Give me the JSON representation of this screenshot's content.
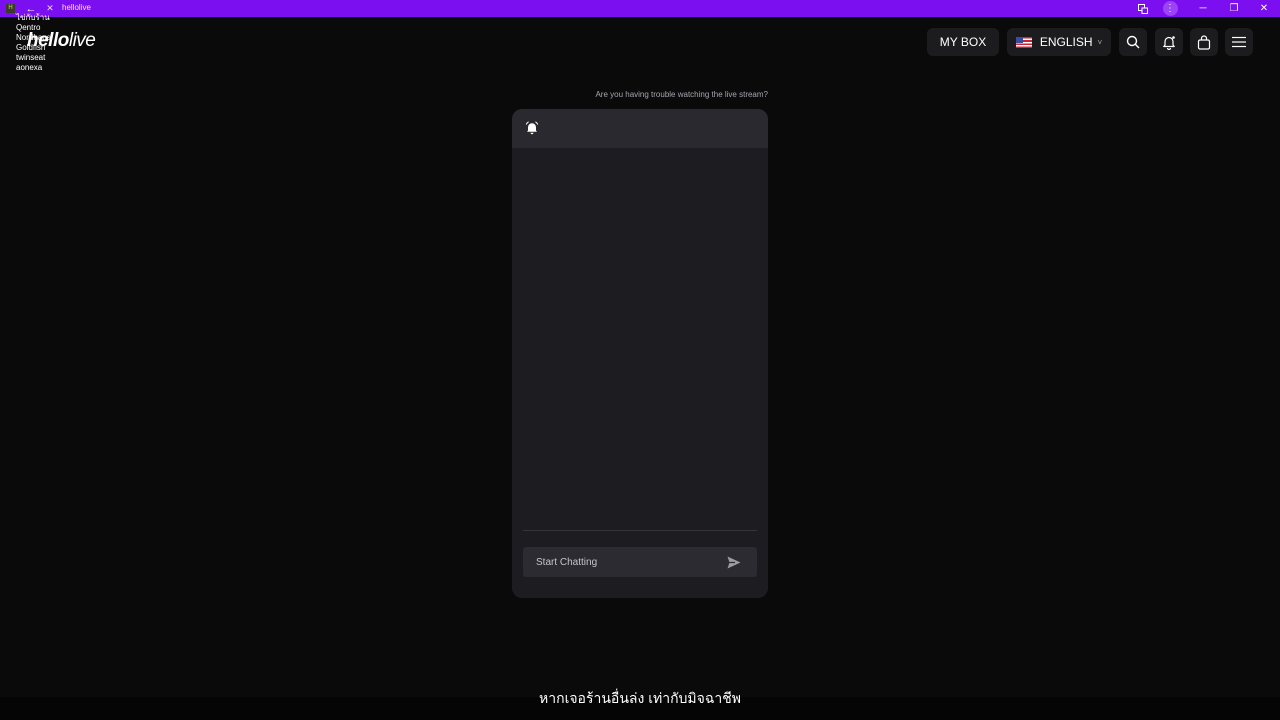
{
  "browser": {
    "title": "hellolive",
    "favicon": "H",
    "back_icon": "←",
    "close_tab_icon": "✕",
    "translate_icon": "translate-icon",
    "more_icon": "⋮",
    "minimize_icon": "─",
    "restore_icon": "❐",
    "close_icon": "✕"
  },
  "overlay_list": [
    "ไข่กับร้าน",
    "Qentro",
    "Nordhaus",
    "Goldfish",
    "twinseat",
    "aonexa"
  ],
  "header": {
    "logo_bold": "hello",
    "logo_light": "live",
    "my_box": "MY BOX",
    "language": "ENGLISH",
    "caret": "˅"
  },
  "notice": "Are you having trouble watching the live stream?",
  "chat": {
    "placeholder": "Start Chatting"
  },
  "caption": "หากเจอร้านอื่นล่ง เท่ากับมิจฉาชีพ",
  "colors": {
    "accent": "#7b0ff0",
    "panel": "#1d1d21",
    "panel_header": "#29292f",
    "bg": "#0a0a0b"
  }
}
